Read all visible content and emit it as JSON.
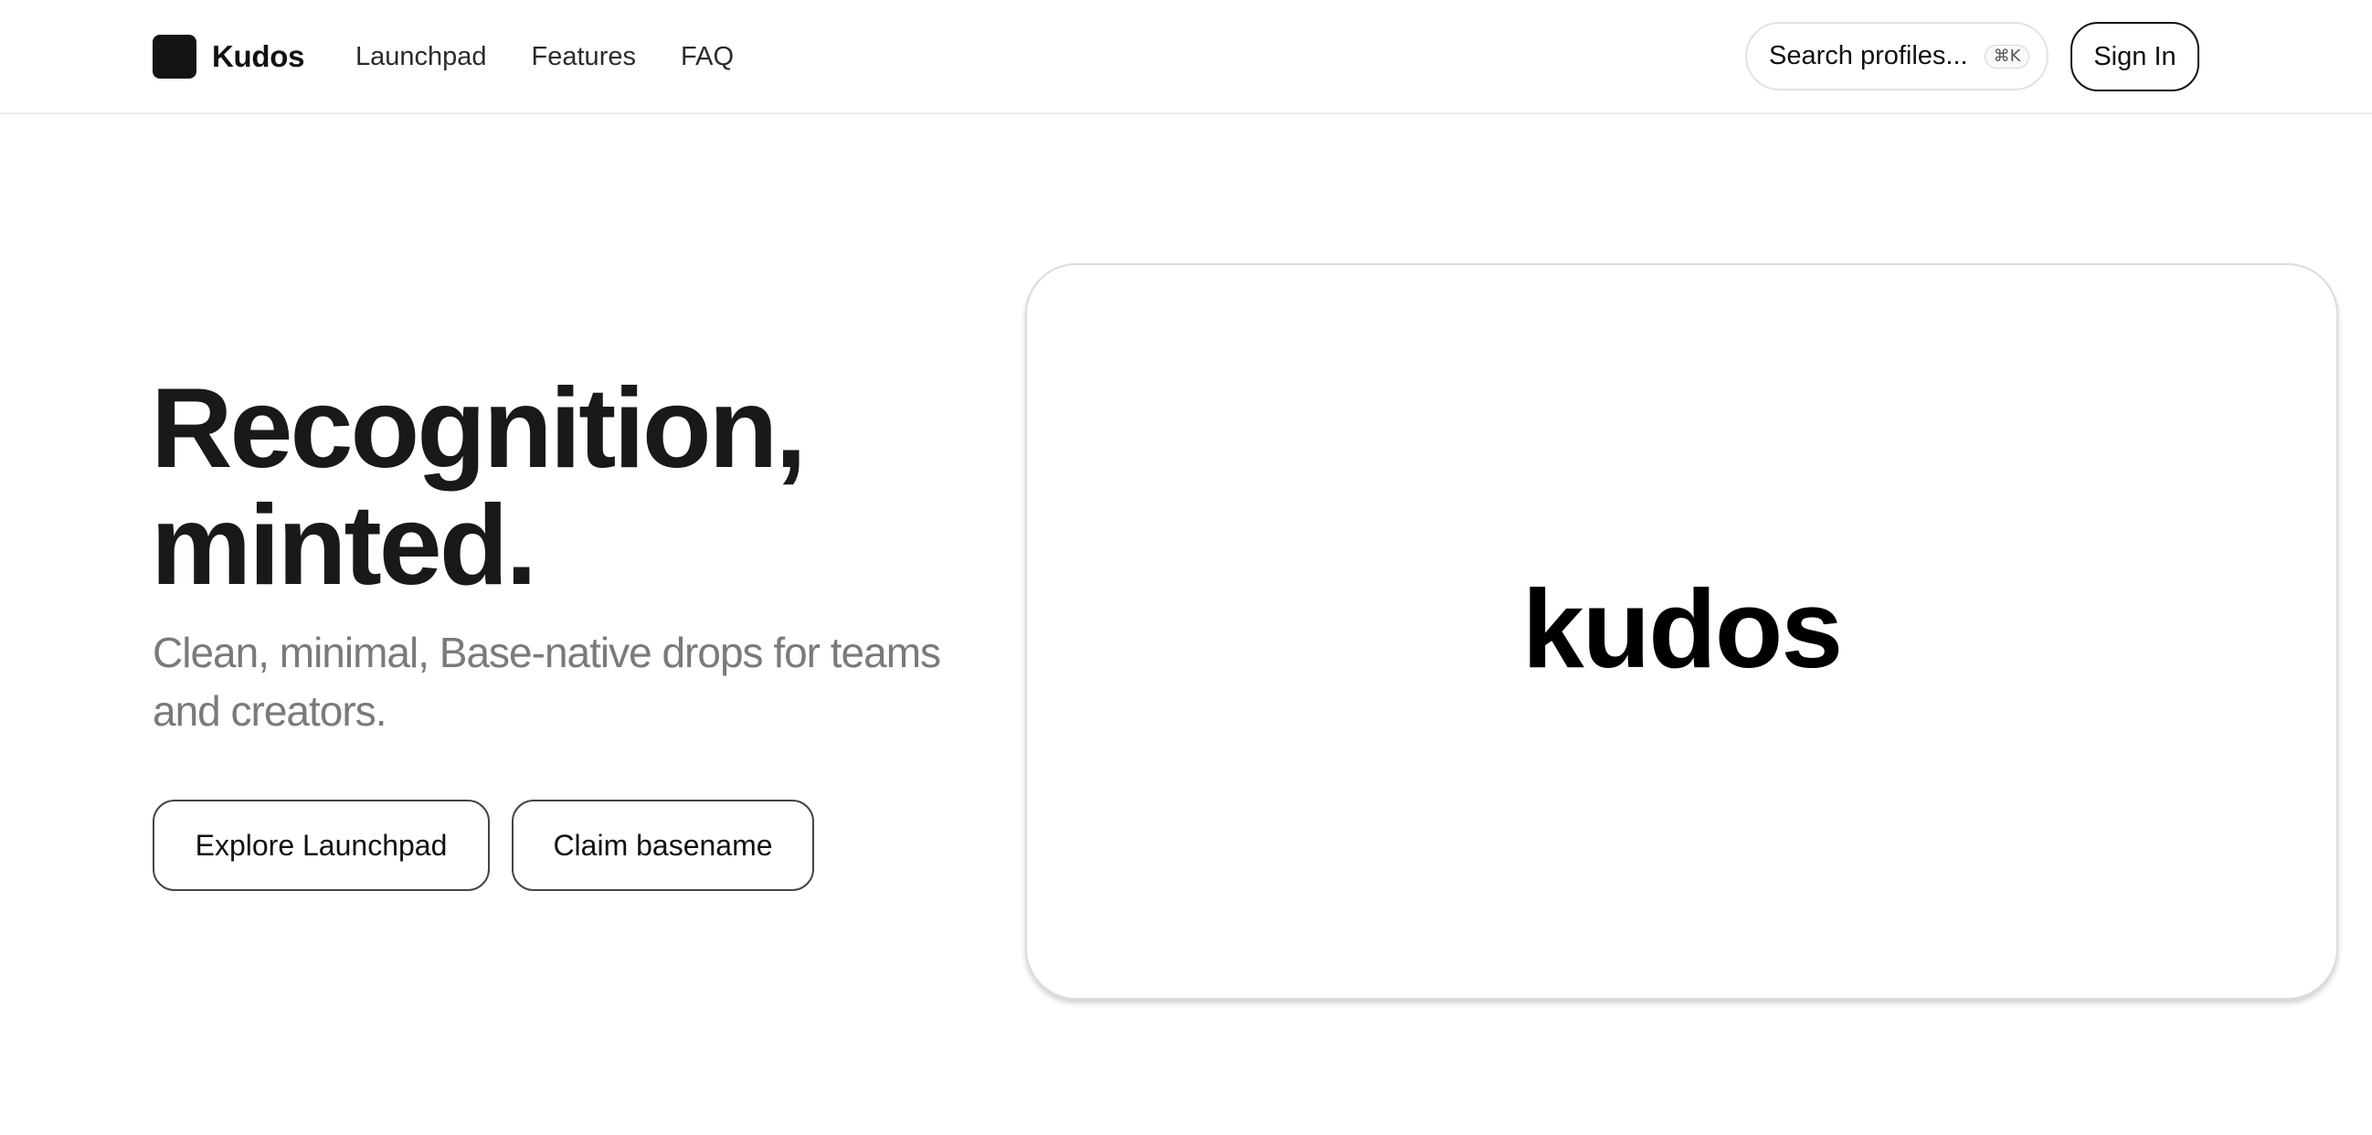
{
  "header": {
    "brand_name": "Kudos",
    "nav": [
      {
        "label": "Launchpad"
      },
      {
        "label": "Features"
      },
      {
        "label": "FAQ"
      }
    ],
    "search": {
      "placeholder": "Search profiles...",
      "shortcut": "⌘K"
    },
    "sign_in_label": "Sign In"
  },
  "hero": {
    "title_line1": "Recognition,",
    "title_line2": "minted.",
    "subtitle": "Clean, minimal, Base-native drops for teams and creators.",
    "buttons": {
      "explore_label": "Explore Launchpad",
      "claim_label": "Claim basename"
    }
  },
  "card": {
    "wordmark": "kudos"
  },
  "colors": {
    "text_primary": "#111111",
    "text_muted": "#7a7a7a",
    "border_light": "#e2e2e2",
    "logo_mark": "#141414"
  }
}
